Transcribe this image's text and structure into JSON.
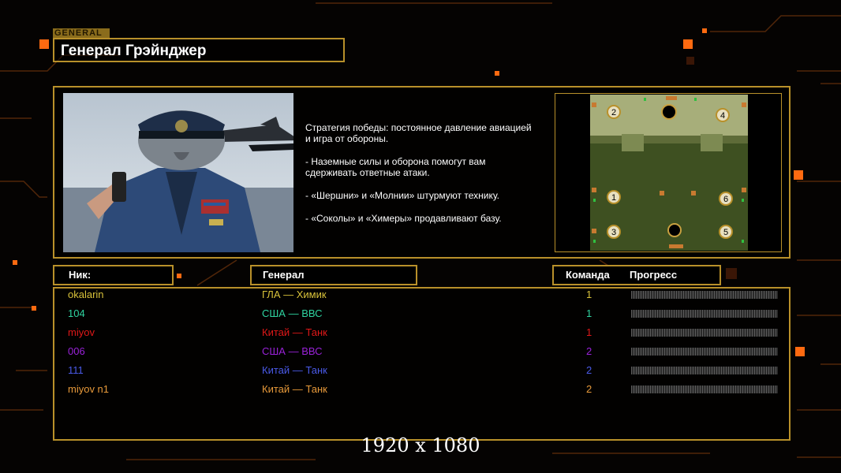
{
  "header": {
    "tag": "GENERAL",
    "title": "Генерал Грэйнджер"
  },
  "strategy": [
    "Стратегия победы: постоянное давление авиацией\n и игра от обороны.",
    "- Наземные силы и оборона помогут вам\n сдерживать ответные атаки.",
    "- «Шершни» и «Молнии» штурмуют технику.",
    "- «Соколы» и «Химеры» продавливают базу."
  ],
  "map": {
    "slots": [
      "1",
      "2",
      "3",
      "4",
      "5",
      "6"
    ]
  },
  "table": {
    "headers": {
      "nick": "Ник:",
      "general": "Генерал",
      "team": "Команда",
      "progress": "Прогресс"
    },
    "rows": [
      {
        "nick": "okalarin",
        "general": "ГЛА — Химик",
        "team": "1",
        "color": "#d8c23a"
      },
      {
        "nick": "104",
        "general": "США — ВВС",
        "team": "1",
        "color": "#2fd4a0"
      },
      {
        "nick": "miyov",
        "general": "Китай — Танк",
        "team": "1",
        "color": "#e01818"
      },
      {
        "nick": "006",
        "general": "США — ВВС",
        "team": "2",
        "color": "#9a22d8"
      },
      {
        "nick": "111",
        "general": "Китай — Танк",
        "team": "2",
        "color": "#4a5ae8"
      },
      {
        "nick": "miyov n1",
        "general": "Китай — Танк",
        "team": "2",
        "color": "#e89a3a"
      }
    ]
  },
  "footer": {
    "resolution": "1920 x 1080"
  },
  "colors": {
    "accent": "#b8902a",
    "glow": "#ff6a10"
  }
}
